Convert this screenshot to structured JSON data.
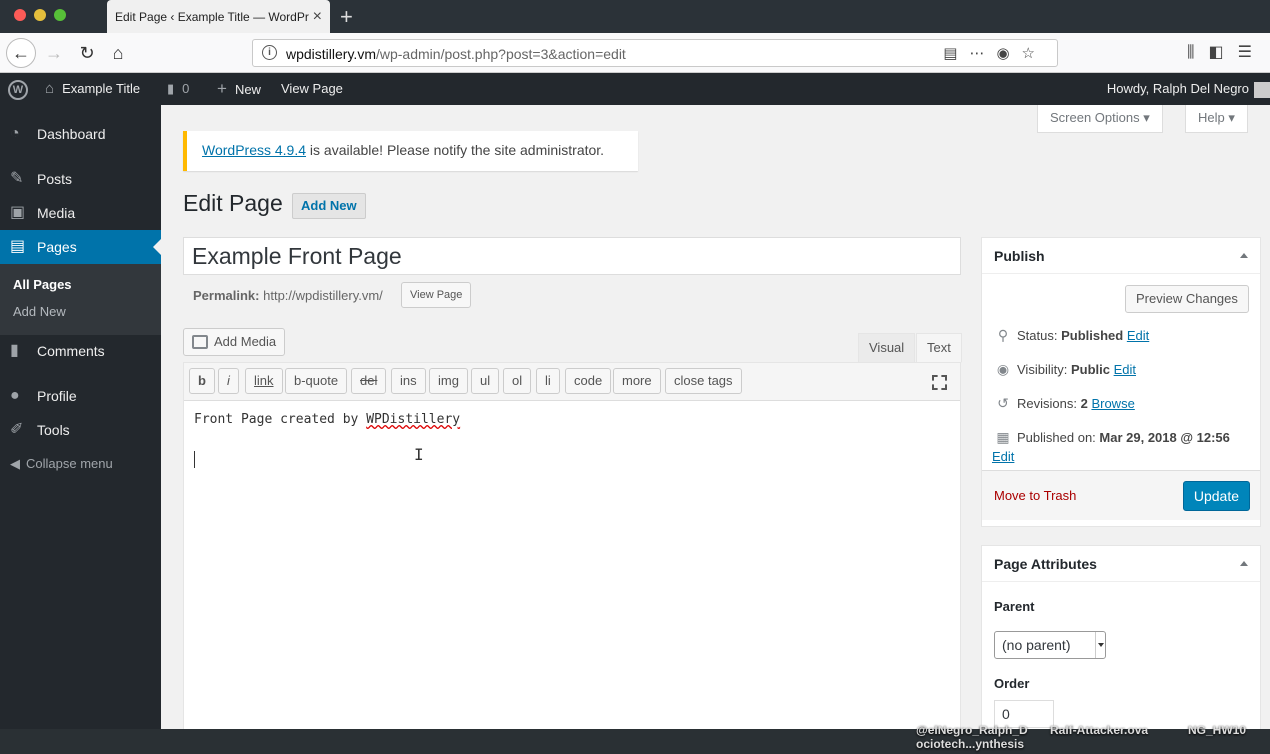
{
  "browser": {
    "tab_title": "Edit Page ‹ Example Title — WordPr",
    "url_domain": "wpdistillery.vm",
    "url_path": "/wp-admin/post.php?post=3&action=edit"
  },
  "adminbar": {
    "site_name": "Example Title",
    "comments_count": "0",
    "new_label": "New",
    "view_page": "View Page",
    "howdy": "Howdy, Ralph Del Negro"
  },
  "sidebar": {
    "items": [
      {
        "label": "Dashboard",
        "icon": "dashboard-icon"
      },
      {
        "label": "Posts",
        "icon": "pin-icon"
      },
      {
        "label": "Media",
        "icon": "media-icon"
      },
      {
        "label": "Pages",
        "icon": "pages-icon"
      },
      {
        "label": "Comments",
        "icon": "comment-icon"
      },
      {
        "label": "Profile",
        "icon": "user-icon"
      },
      {
        "label": "Tools",
        "icon": "wrench-icon"
      }
    ],
    "submenu": [
      "All Pages",
      "Add New"
    ],
    "collapse": "Collapse menu"
  },
  "screen_options": "Screen Options",
  "help": "Help",
  "notice": {
    "link": "WordPress 4.9.4",
    "text": " is available! Please notify the site administrator."
  },
  "heading": "Edit Page",
  "add_new": "Add New",
  "title_value": "Example Front Page",
  "permalink": {
    "label": "Permalink:",
    "url": "http://wpdistillery.vm/",
    "button": "View Page"
  },
  "editor": {
    "add_media": "Add Media",
    "tab_visual": "Visual",
    "tab_text": "Text",
    "quicktags": [
      "b",
      "i",
      "link",
      "b-quote",
      "del",
      "ins",
      "img",
      "ul",
      "ol",
      "li",
      "code",
      "more",
      "close tags"
    ],
    "content_prefix": "Front Page created by ",
    "content_misspelled": "WPDistillery"
  },
  "publish": {
    "title": "Publish",
    "preview": "Preview Changes",
    "status_label": "Status:",
    "status_value": "Published",
    "visibility_label": "Visibility:",
    "visibility_value": "Public",
    "revisions_label": "Revisions:",
    "revisions_value": "2",
    "browse": "Browse",
    "published_label": "Published on:",
    "published_value": "Mar 29, 2018 @ 12:56",
    "edit": "Edit",
    "trash": "Move to Trash",
    "update": "Update"
  },
  "attributes": {
    "title": "Page Attributes",
    "parent_label": "Parent",
    "parent_value": "(no parent)",
    "order_label": "Order",
    "order_value": "0"
  },
  "desktop": {
    "file1_line1": "@elNegro_Ralph_D",
    "file1_line2": "ociotech...ynthesis",
    "file2": "Ralf-Attacker.ova",
    "file3": "NG_HW10"
  },
  "colors": {
    "admin_blue": "#0073aa",
    "notice_yellow": "#ffb900",
    "update_blue": "#0085ba"
  }
}
